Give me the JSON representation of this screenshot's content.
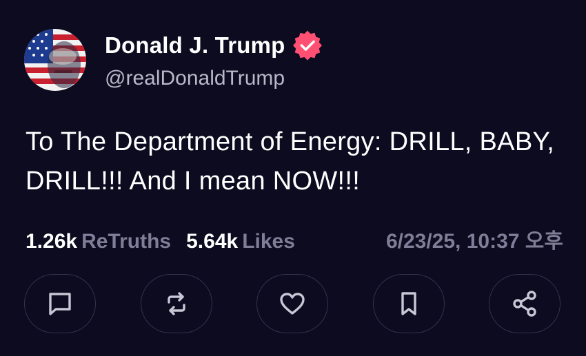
{
  "author": {
    "display_name": "Donald J. Trump",
    "handle": "@realDonaldTrump",
    "verified": true,
    "badge_color": "#ff4f73"
  },
  "post": {
    "text": "To The Department of Energy: DRILL, BABY, DRILL!!! And I mean NOW!!!",
    "retruths_count": "1.26k",
    "retruths_label": "ReTruths",
    "likes_count": "5.64k",
    "likes_label": "Likes",
    "timestamp": "6/23/25, 10:37 오후"
  },
  "actions": [
    {
      "name": "reply",
      "icon": "comment-icon"
    },
    {
      "name": "retruth",
      "icon": "repost-icon"
    },
    {
      "name": "like",
      "icon": "heart-icon"
    },
    {
      "name": "bookmark",
      "icon": "bookmark-icon"
    },
    {
      "name": "share",
      "icon": "share-icon"
    }
  ],
  "colors": {
    "background": "#0c0b1f",
    "muted_text": "#7f7d97",
    "handle_text": "#b9b8c8",
    "button_border": "#35334d",
    "icon": "#c9c7d6"
  }
}
